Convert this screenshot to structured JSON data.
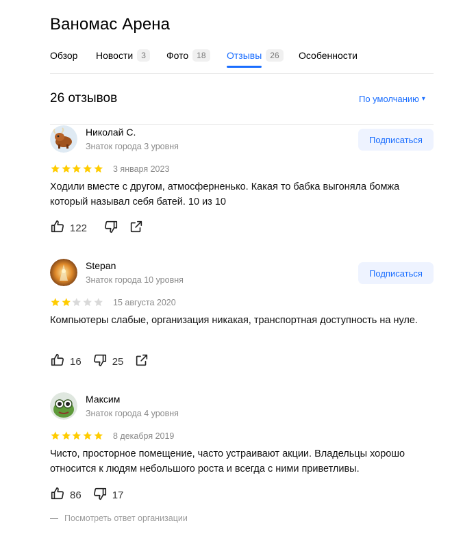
{
  "header": {
    "title": "Ваномас Арена"
  },
  "tabs": [
    {
      "label": "Обзор",
      "count": ""
    },
    {
      "label": "Новости",
      "count": "3"
    },
    {
      "label": "Фото",
      "count": "18"
    },
    {
      "label": "Отзывы",
      "count": "26"
    },
    {
      "label": "Особенности",
      "count": ""
    }
  ],
  "reviews_header": {
    "count_label": "26 отзывов",
    "sort_label": "По умолчанию",
    "sort_arrow": "▾"
  },
  "reviews": [
    {
      "author": "Николай С.",
      "level": "Знаток города 3 уровня",
      "subscribe_label": "Подписаться",
      "rating": 5,
      "date": "3 января 2023",
      "text": "Ходили вместе с другом, атмосферненько. Какая то бабка выгоняла бомжа который называл себя батей. 10 из 10",
      "likes": "122",
      "dislikes": ""
    },
    {
      "author": "Stepan",
      "level": "Знаток города 10 уровня",
      "subscribe_label": "Подписаться",
      "rating": 2,
      "date": "15 августа 2020",
      "text": "Компьютеры слабые, организация никакая, транспортная доступность на нуле.",
      "likes": "16",
      "dislikes": "25"
    },
    {
      "author": "Максим",
      "level": "Знаток города 4 уровня",
      "subscribe_label": "",
      "rating": 5,
      "date": "8 декабря 2019",
      "text": "Чисто, просторное помещение, часто устраивают акции. Владельцы хорошо относится к людям небольшого роста и всегда с ними приветливы.",
      "likes": "86",
      "dislikes": "17"
    }
  ],
  "org_answer_label": "Посмотреть ответ организации",
  "colors": {
    "accent": "#196dff",
    "star_filled": "#fc0",
    "star_empty": "#d9d9d9"
  },
  "icons": [
    "thumbs-up-icon",
    "thumbs-down-icon",
    "share-icon"
  ]
}
